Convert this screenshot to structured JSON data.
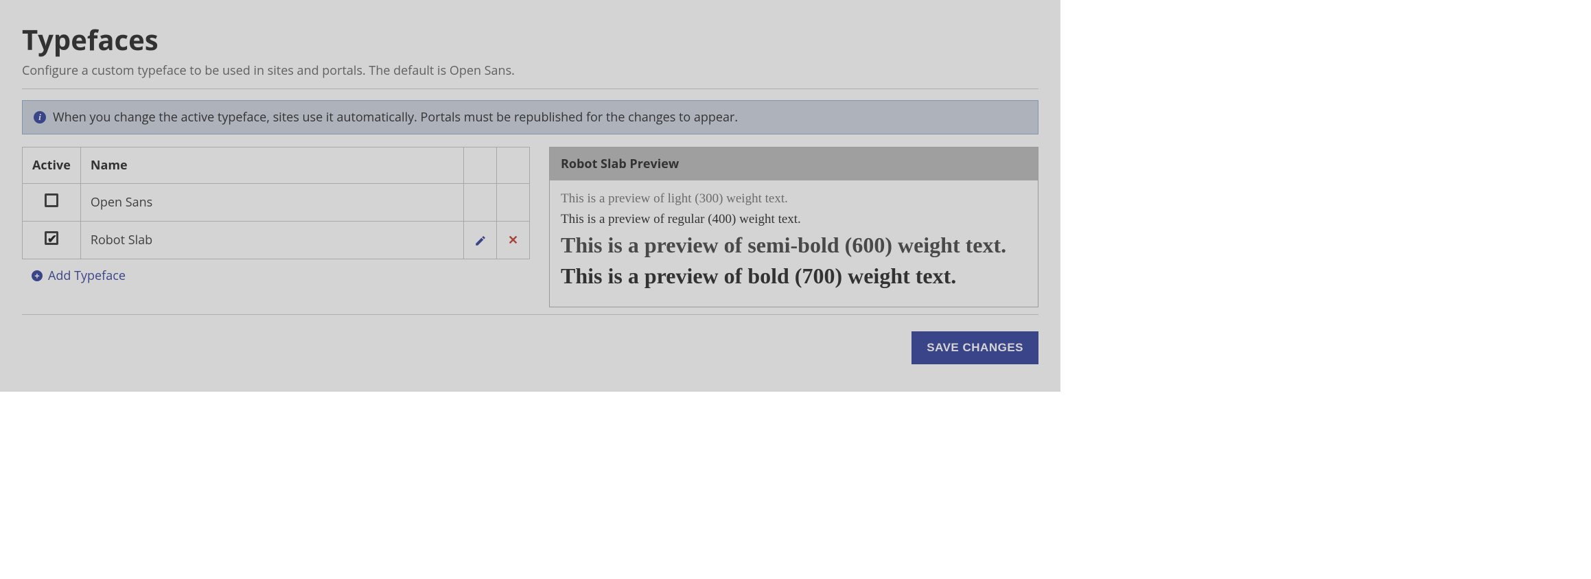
{
  "header": {
    "title": "Typefaces",
    "subtitle": "Configure a custom typeface to be used in sites and portals. The default is Open Sans."
  },
  "info_banner": {
    "text": "When you change the active typeface, sites use it automatically. Portals must be republished for the changes to appear."
  },
  "table": {
    "columns": {
      "active": "Active",
      "name": "Name"
    },
    "rows": [
      {
        "name": "Open Sans",
        "active": false,
        "editable": false
      },
      {
        "name": "Robot Slab",
        "active": true,
        "editable": true
      }
    ],
    "add_label": "Add Typeface"
  },
  "preview": {
    "title": "Robot Slab Preview",
    "w300": "This is a preview of light (300) weight text.",
    "w400": "This is a preview of regular (400) weight text.",
    "w600": "This is a preview of semi-bold (600) weight text.",
    "w700": "This is a preview of bold (700) weight text."
  },
  "actions": {
    "save": "SAVE CHANGES"
  }
}
